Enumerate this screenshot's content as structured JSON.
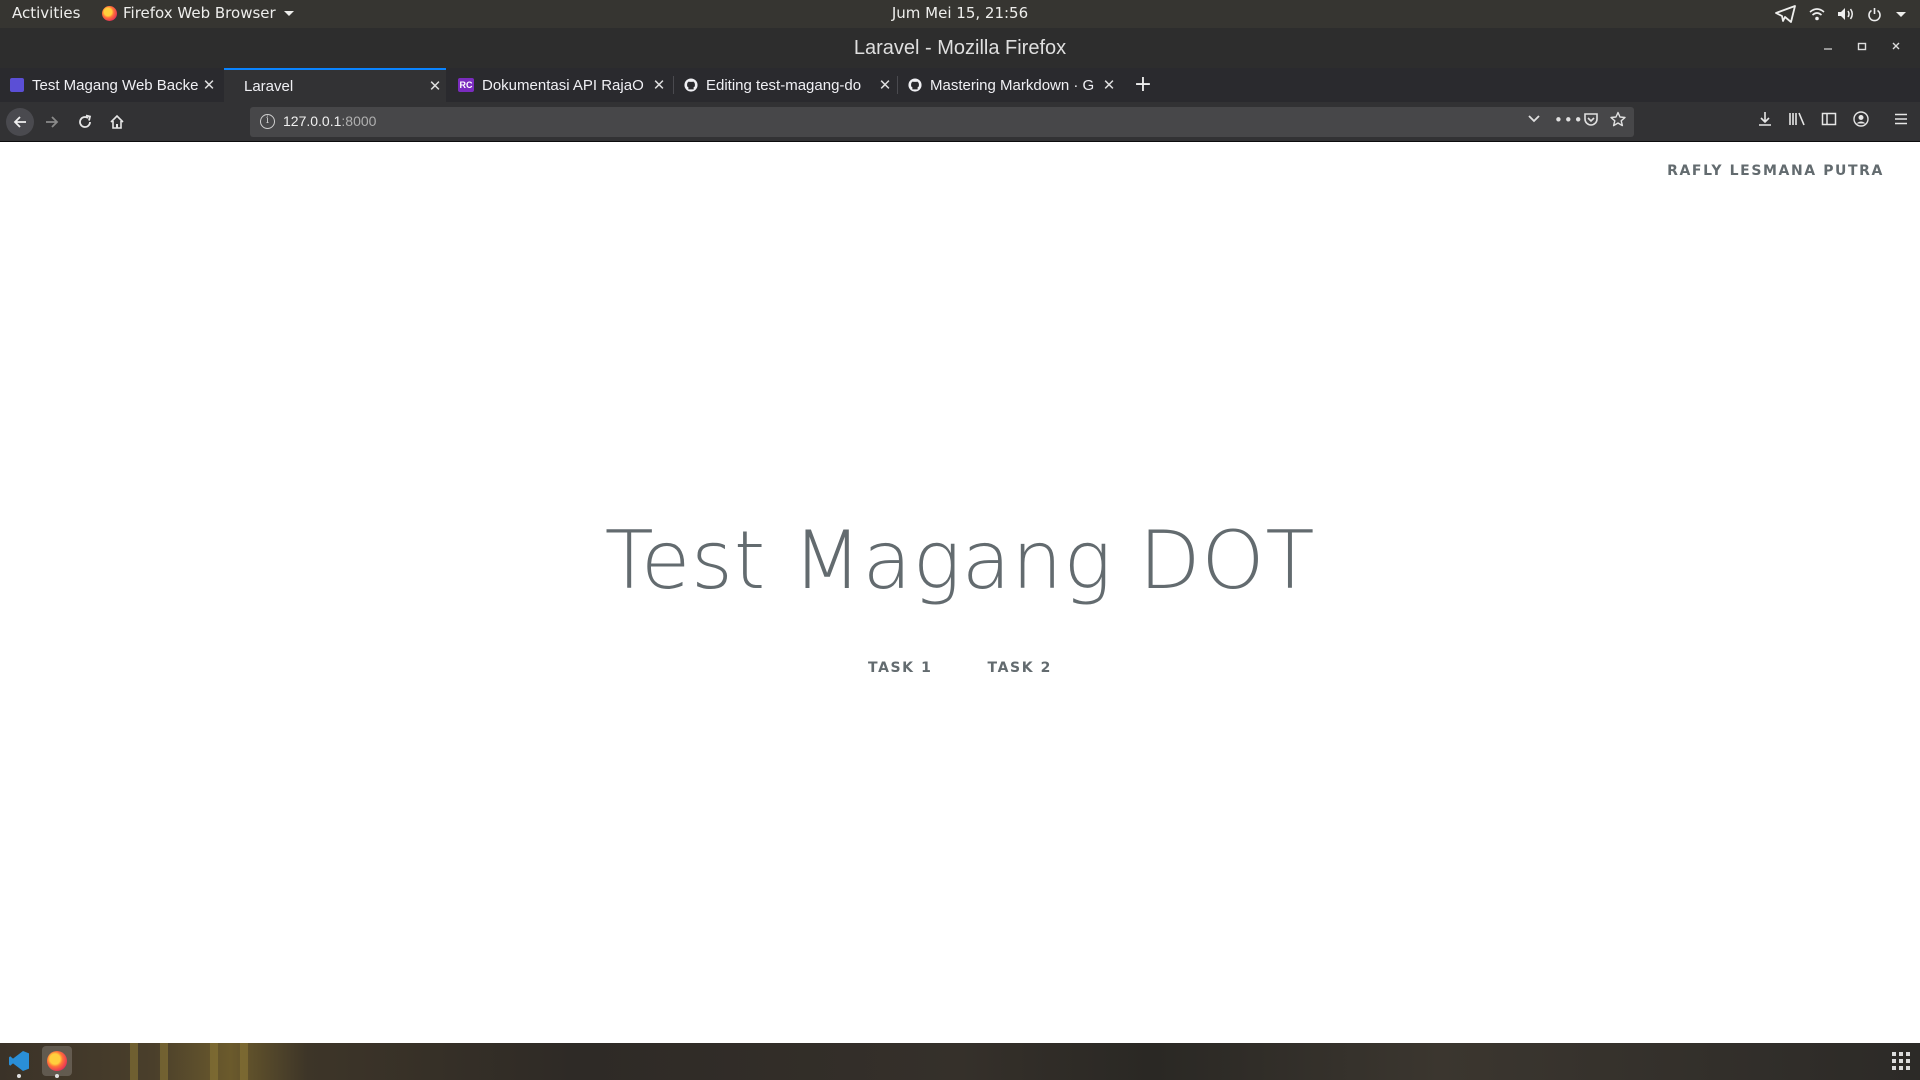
{
  "topbar": {
    "activities": "Activities",
    "app_menu": "Firefox Web Browser",
    "clock": "Jum Mei 15, 21:56",
    "tray_icons": [
      "telegram-icon",
      "wifi-icon",
      "volume-icon",
      "power-icon"
    ]
  },
  "window": {
    "title": "Laravel - Mozilla Firefox",
    "controls": [
      "minimize",
      "maximize",
      "close"
    ]
  },
  "tabs": [
    {
      "label": "Test Magang Web Backe",
      "favicon_color": "#5b4fd6"
    },
    {
      "label": "Laravel",
      "active": true
    },
    {
      "label": "Dokumentasi API RajaO",
      "favicon_color": "#7b2cbf",
      "favicon_text": "RC"
    },
    {
      "label": "Editing test-magang-do",
      "favicon": "github-icon"
    },
    {
      "label": "Mastering Markdown · G",
      "favicon": "github-icon"
    }
  ],
  "navbar": {
    "url_host": "127.0.0.1",
    "url_port": ":8000"
  },
  "page": {
    "author": "RAFLY LESMANA PUTRA",
    "heading": "Test Magang DOT",
    "links": [
      "TASK 1",
      "TASK 2"
    ]
  },
  "colors": {
    "text": "#636b6f",
    "tab_accent": "#0a84ff"
  }
}
